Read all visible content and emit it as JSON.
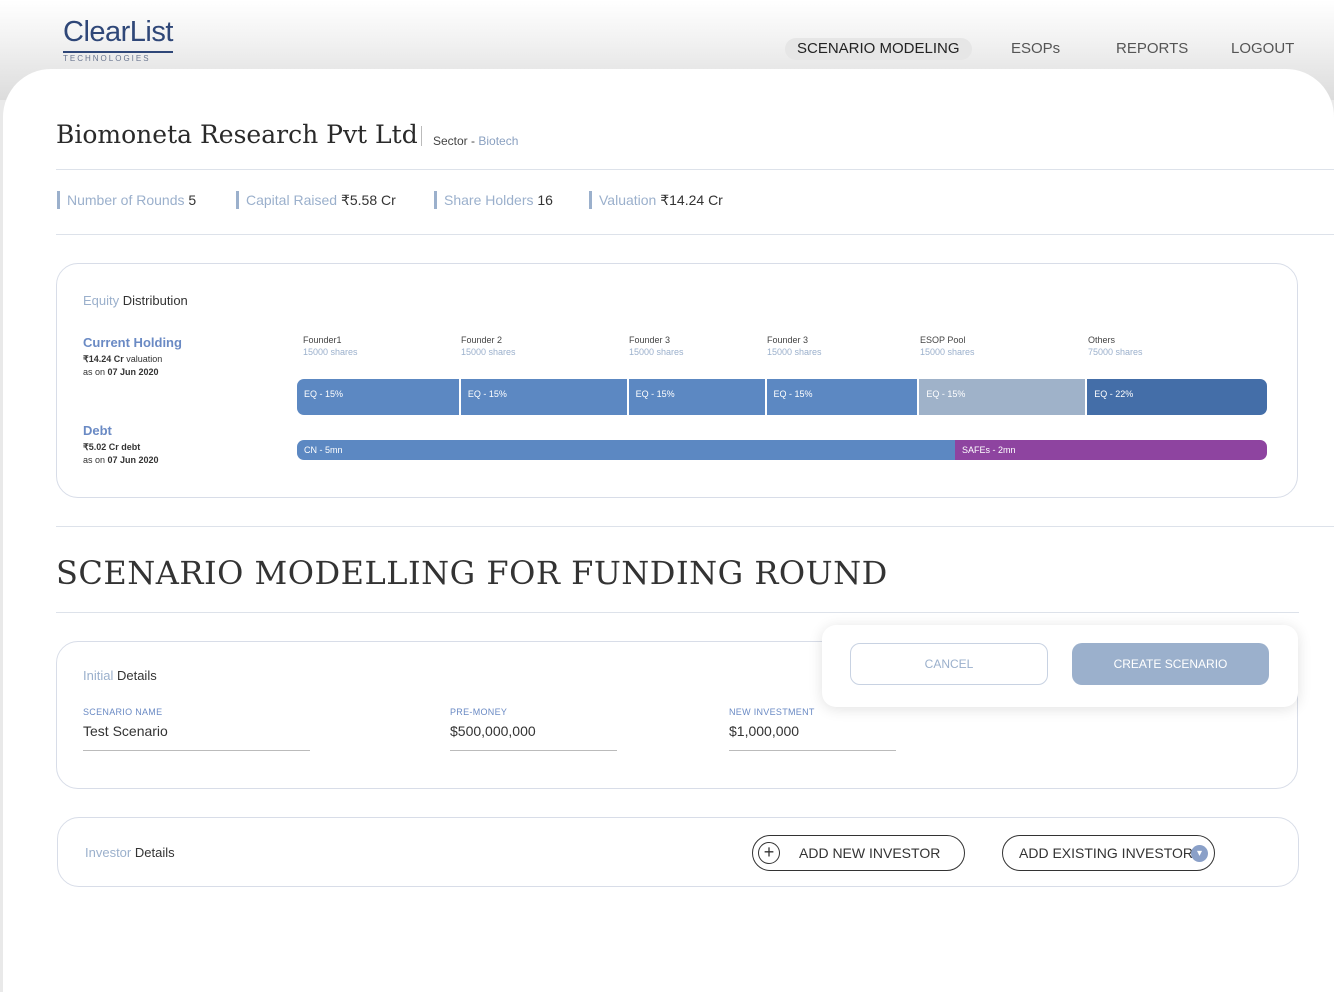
{
  "header": {
    "logo_name": "ClearList",
    "logo_sub": "TECHNOLOGIES",
    "nav": [
      "SCENARIO MODELING",
      "ESOPs",
      "REPORTS",
      "LOGOUT"
    ]
  },
  "company": {
    "name": "Biomoneta Research Pvt Ltd",
    "sector_label": "Sector - ",
    "sector_value": "Biotech"
  },
  "stats": [
    {
      "label": "Number of Rounds",
      "value": "5"
    },
    {
      "label": "Capital Raised",
      "value": "₹5.58 Cr"
    },
    {
      "label": "Share Holders",
      "value": "16"
    },
    {
      "label": "Valuation",
      "value": "₹14.24 Cr"
    }
  ],
  "equity": {
    "title_light": "Equity",
    "title": " Distribution",
    "current_holding": {
      "title": "Current Holding",
      "valuation_value": "₹14.24 Cr",
      "valuation_text": " valuation",
      "as_on_label": "as on ",
      "as_on_date": "07 Jun 2020"
    },
    "debt": {
      "title": "Debt",
      "debt_value": "₹5.02 Cr debt",
      "as_on_label": "as on ",
      "as_on_date": "07 Jun 2020"
    },
    "shareholders": [
      {
        "name": "Founder1",
        "shares": "15000 shares"
      },
      {
        "name": "Founder 2",
        "shares": "15000 shares"
      },
      {
        "name": "Founder 3",
        "shares": "15000 shares"
      },
      {
        "name": "Founder 3",
        "shares": "15000 shares"
      },
      {
        "name": "ESOP Pool",
        "shares": "15000 shares"
      },
      {
        "name": "Others",
        "shares": "75000 shares"
      }
    ],
    "equity_segments": [
      {
        "label": "EQ - 15%",
        "color": "#5c88c2"
      },
      {
        "label": "EQ - 15%",
        "color": "#5c88c2"
      },
      {
        "label": "EQ - 15%",
        "color": "#5c88c2"
      },
      {
        "label": "EQ - 15%",
        "color": "#5c88c2"
      },
      {
        "label": "EQ - 15%",
        "color": "#9fb2c9"
      },
      {
        "label": "EQ - 22%",
        "color": "#446ea8"
      }
    ],
    "debt_segments": [
      {
        "label": "CN - 5mn",
        "color": "#5c88c2"
      },
      {
        "label": "SAFEs - 2mn",
        "color": "#8e44a0"
      }
    ]
  },
  "scenario": {
    "title": "SCENARIO MODELLING FOR FUNDING ROUND",
    "initial_light": "Initial",
    "initial_title": " Details",
    "fields": [
      {
        "label": "SCENARIO NAME",
        "value": "Test Scenario"
      },
      {
        "label": "PRE-MONEY",
        "value": "$500,000,000"
      },
      {
        "label": "NEW INVESTMENT",
        "value": "$1,000,000"
      }
    ],
    "cancel_label": "CANCEL",
    "create_label": "CREATE SCENARIO",
    "investor_light": "Investor",
    "investor_title": " Details",
    "add_new_label": "ADD NEW INVESTOR",
    "add_existing_label": "ADD EXISTING INVESTOR"
  }
}
